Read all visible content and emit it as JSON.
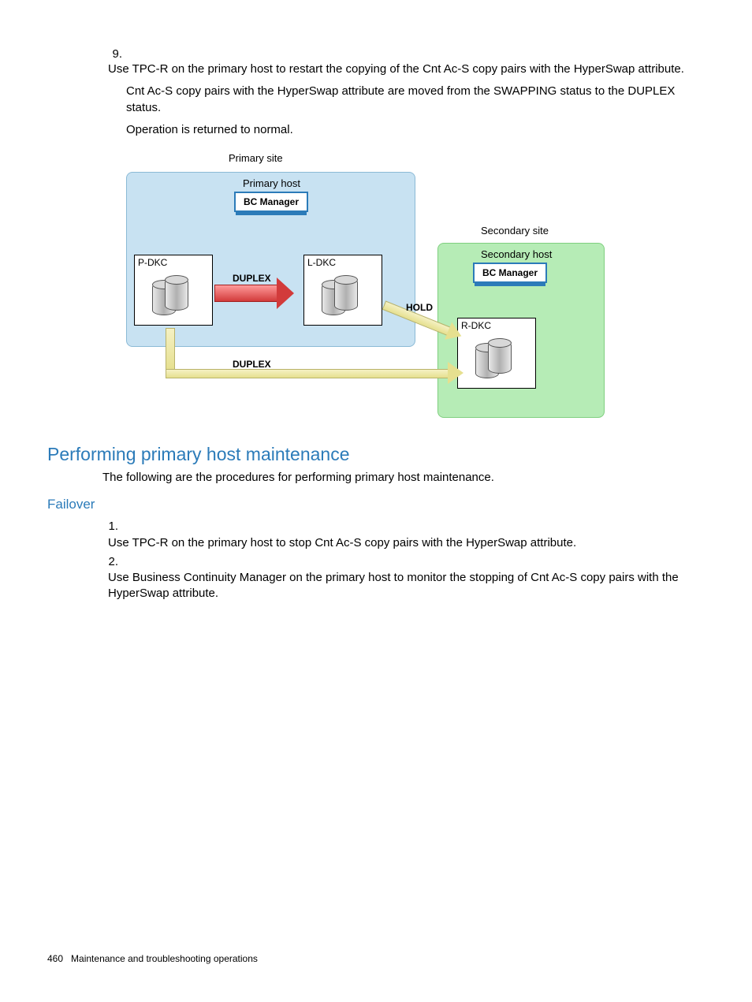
{
  "step9": {
    "number": "9.",
    "line1": "Use TPC-R on the primary host to restart the copying of the Cnt Ac-S copy pairs with the HyperSwap attribute.",
    "line2": "Cnt Ac-S copy pairs with the HyperSwap attribute are moved from the SWAPPING status to the DUPLEX status.",
    "line3": "Operation is returned to normal."
  },
  "diagram": {
    "primary_site": "Primary site",
    "primary_host": "Primary host",
    "secondary_site": "Secondary site",
    "secondary_host": "Secondary host",
    "bc_manager": "BC Manager",
    "p_dkc": "P-DKC",
    "l_dkc": "L-DKC",
    "r_dkc": "R-DKC",
    "duplex": "DUPLEX",
    "hold": "HOLD"
  },
  "section": {
    "title": "Performing primary host maintenance",
    "intro": "The following are the procedures for performing primary host maintenance."
  },
  "failover": {
    "title": "Failover",
    "step1_num": "1.",
    "step1": "Use TPC-R on the primary host to stop Cnt Ac-S copy pairs with the HyperSwap attribute.",
    "step2_num": "2.",
    "step2": "Use Business Continuity Manager on the primary host to monitor the stopping of Cnt Ac-S copy pairs with the HyperSwap attribute."
  },
  "footer": {
    "page_num": "460",
    "chapter": "Maintenance and troubleshooting operations"
  }
}
